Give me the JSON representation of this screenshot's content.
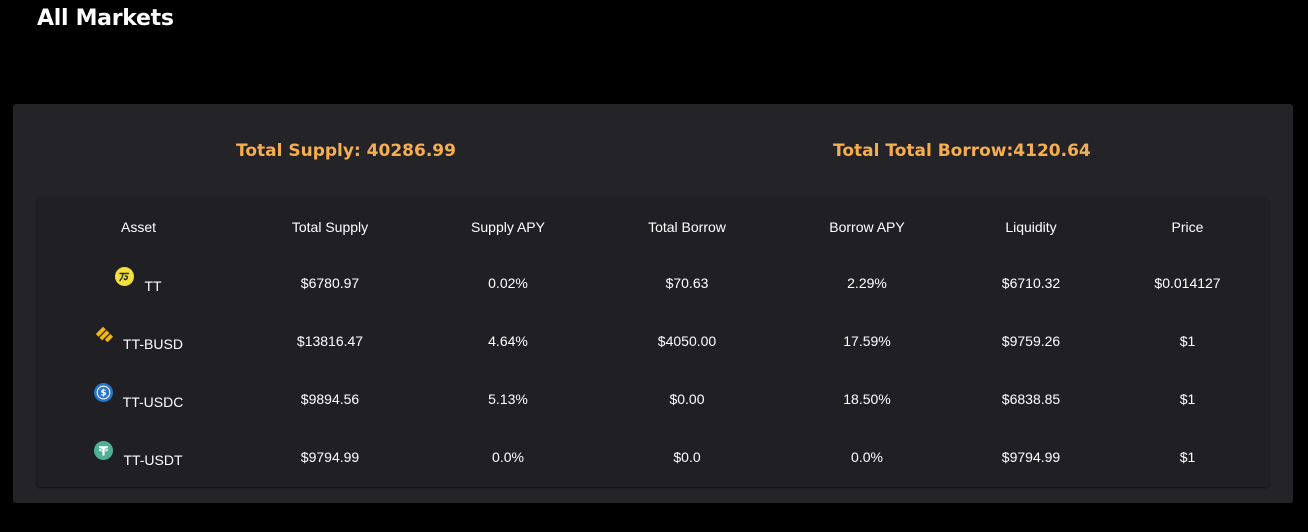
{
  "page": {
    "title": "All Markets"
  },
  "totals": {
    "supply": "Total Supply: 40286.99",
    "borrow": "Total Total Borrow:4120.64"
  },
  "table": {
    "headers": [
      "Asset",
      "Total Supply",
      "Supply APY",
      "Total Borrow",
      "Borrow APY",
      "Liquidity",
      "Price"
    ],
    "rows": [
      {
        "asset": "TT",
        "icon": "tt-token-icon",
        "total_supply": "$6780.97",
        "supply_apy": "0.02%",
        "total_borrow": "$70.63",
        "borrow_apy": "2.29%",
        "liquidity": "$6710.32",
        "price": "$0.014127"
      },
      {
        "asset": "TT-BUSD",
        "icon": "busd-token-icon",
        "total_supply": "$13816.47",
        "supply_apy": "4.64%",
        "total_borrow": "$4050.00",
        "borrow_apy": "17.59%",
        "liquidity": "$9759.26",
        "price": "$1"
      },
      {
        "asset": "TT-USDC",
        "icon": "usdc-token-icon",
        "total_supply": "$9894.56",
        "supply_apy": "5.13%",
        "total_borrow": "$0.00",
        "borrow_apy": "18.50%",
        "liquidity": "$6838.85",
        "price": "$1"
      },
      {
        "asset": "TT-USDT",
        "icon": "usdt-token-icon",
        "total_supply": "$9794.99",
        "supply_apy": "0.0%",
        "total_borrow": "$0.0",
        "borrow_apy": "0.0%",
        "liquidity": "$9794.99",
        "price": "$1"
      }
    ]
  },
  "colors": {
    "background": "#000000",
    "panel": "#232328",
    "accent": "#f6ae4f",
    "tt_yellow": "#f3e03c",
    "busd_yellow": "#f0b90b",
    "usdc_blue": "#2775ca",
    "usdt_green": "#50af95"
  }
}
